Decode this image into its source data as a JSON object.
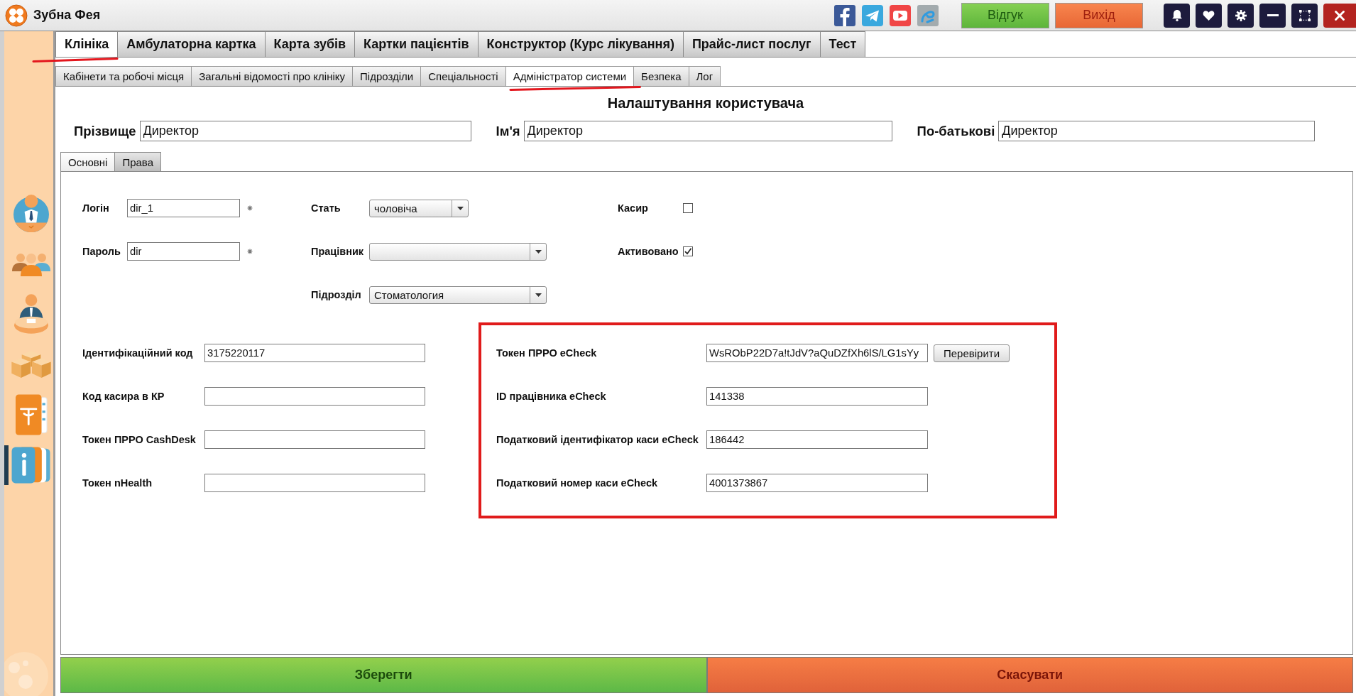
{
  "window": {
    "title": "Зубна Фея"
  },
  "title_bar": {
    "buttons": [
      {
        "label": "Відгук",
        "kind": "feedback"
      },
      {
        "label": "Вихід",
        "kind": "exit"
      }
    ]
  },
  "sidebar": {
    "items": [
      {
        "kind": "person",
        "selected": false
      },
      {
        "kind": "group",
        "selected": false
      },
      {
        "kind": "desk",
        "selected": false
      },
      {
        "kind": "boxes",
        "selected": false
      },
      {
        "kind": "book",
        "selected": false
      },
      {
        "kind": "cards",
        "selected": true
      }
    ]
  },
  "main_tabs": [
    {
      "label": "Клініка",
      "selected": true,
      "marked": true
    },
    {
      "label": "Амбулаторна картка",
      "selected": false,
      "marked": false
    },
    {
      "label": "Карта зубів",
      "selected": false,
      "marked": false
    },
    {
      "label": "Картки пацієнтів",
      "selected": false,
      "marked": false
    },
    {
      "label": "Конструктор (Курс лікування)",
      "selected": false,
      "marked": false
    },
    {
      "label": "Прайс-лист послуг",
      "selected": false,
      "marked": false
    },
    {
      "label": "Тест",
      "selected": false,
      "marked": false
    }
  ],
  "sub_tabs": [
    {
      "label": "Кабінети та робочі місця",
      "selected": false,
      "marked": false
    },
    {
      "label": "Загальні відомості про клініку",
      "selected": false,
      "marked": false
    },
    {
      "label": "Підрозділи",
      "selected": false,
      "marked": false
    },
    {
      "label": "Спеціальності",
      "selected": false,
      "marked": false
    },
    {
      "label": "Адміністратор системи",
      "selected": true,
      "marked": true
    },
    {
      "label": "Безпека",
      "selected": false,
      "marked": false
    },
    {
      "label": "Лог",
      "selected": false,
      "marked": false
    }
  ],
  "user_settings": {
    "title": "Налаштування користувача",
    "name_fields": [
      {
        "label": "Прізвище",
        "value": "Директор"
      },
      {
        "label": "Ім'я",
        "value": "Директор"
      },
      {
        "label": "По-батькові",
        "value": "Директор"
      }
    ],
    "tabs": [
      {
        "label": "Основні",
        "selected": true
      },
      {
        "label": "Права",
        "selected": false
      }
    ],
    "account_fields": [
      {
        "label": "Логін",
        "value": "dir_1",
        "required": true
      },
      {
        "label": "Пароль",
        "value": "dir",
        "required": true
      }
    ],
    "select_fields": [
      {
        "label": "Стать",
        "value": "чоловіча"
      },
      {
        "label": "Працівник"
      },
      {
        "label": "Підрозділ",
        "value": "Стоматология"
      }
    ],
    "check_fields": [
      {
        "label": "Касир",
        "checked": false
      },
      {
        "label": "Активовано",
        "checked": true
      }
    ],
    "id_fields": [
      {
        "label": "Ідентифікаційний код",
        "value": "3175220117"
      },
      {
        "label": "Код касира в КР"
      },
      {
        "label": "Токен ПРРО CashDesk"
      },
      {
        "label": "Токен nHealth"
      }
    ],
    "echeck_section": {
      "marked": true,
      "fields": [
        {
          "label": "Токен ПРРО eCheck",
          "value": "WsRObP22D7a!tJdV?aQuDZfXh6lS/LG1sYy",
          "button": "Перевірити"
        },
        {
          "label": "ID працівника eCheck",
          "value": "141338"
        },
        {
          "label": "Податковий ідентифікатор каси eCheck",
          "value": "186442"
        },
        {
          "label": "Податковий номер каси eCheck",
          "value": "4001373867"
        }
      ]
    }
  },
  "actions": [
    {
      "label": "Зберегти",
      "kind": "save"
    },
    {
      "label": "Скасувати",
      "kind": "cancel"
    }
  ]
}
